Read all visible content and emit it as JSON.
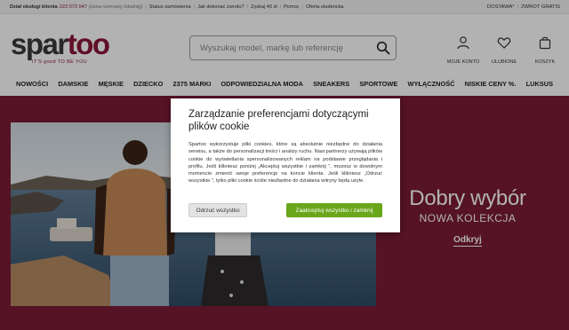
{
  "topbar": {
    "service_label": "Dział obsługi klienta",
    "phone": "223 072 047",
    "hours": "(cena rozmowy lokalnej)",
    "links": [
      "Status zamówienia",
      "Jak dokonać zwrotu?",
      "Zyskaj 40 zł",
      "Pomoc",
      "Oferta studencka"
    ],
    "right_links": [
      "DOSTAWA*",
      "ZWROT GRATIS"
    ]
  },
  "logo": {
    "spar": "spar",
    "too": "too",
    "tagline": "IT'S good TO BE YOU"
  },
  "search": {
    "placeholder": "Wyszukaj model, markę lub referencję"
  },
  "header_icons": [
    {
      "icon": "user-icon",
      "label": "MOJE KONTO"
    },
    {
      "icon": "heart-icon",
      "label": "ULUBIONE"
    },
    {
      "icon": "bag-icon",
      "label": "KOSZYK"
    }
  ],
  "nav": [
    "NOWOŚCI",
    "DAMSKIE",
    "MĘSKIE",
    "DZIECKO",
    "2375 MARKI",
    "ODPOWIEDZIALNA MODA",
    "SNEAKERS",
    "SPORTOWE",
    "WYŁĄCZNOŚĆ",
    "NISKIE CENY %.",
    "LUKSUS"
  ],
  "hero": {
    "title": "Dobry wybór",
    "subtitle": "NOWA KOLEKCJA",
    "cta": "Odkryj"
  },
  "cookie_modal": {
    "title": "Zarządzanie preferencjami dotyczącymi plików cookie",
    "body": "Spartoo wykorzystuje pliki cookies, które są absolutnie niezbędne do działania serwisu, a także do personalizacji treści i analizy ruchu. Nasi partnerzy używają plików cookie do wyświetlania spersonalizowanych reklam na podstawie przeglądania i profilu. Jeśli klikniesz poniżej „Akceptuj wszystkie i zamknij ”, mozesz w dowolnym momencie zmienić swoje preferencje na koncie klienta. Jeśli klikniesz „Odrzuć wszystkie ”, tylko pliki cookie ściśle niezbędne do działania witryny będą użyte.",
    "reject_label": "Odrzuć wszystko",
    "accept_label": "Zaakceptuj wszystko i zamknij"
  },
  "colors": {
    "brand": "#8b1538",
    "hero_bg": "#7a1c35",
    "accept": "#6aa61c"
  }
}
